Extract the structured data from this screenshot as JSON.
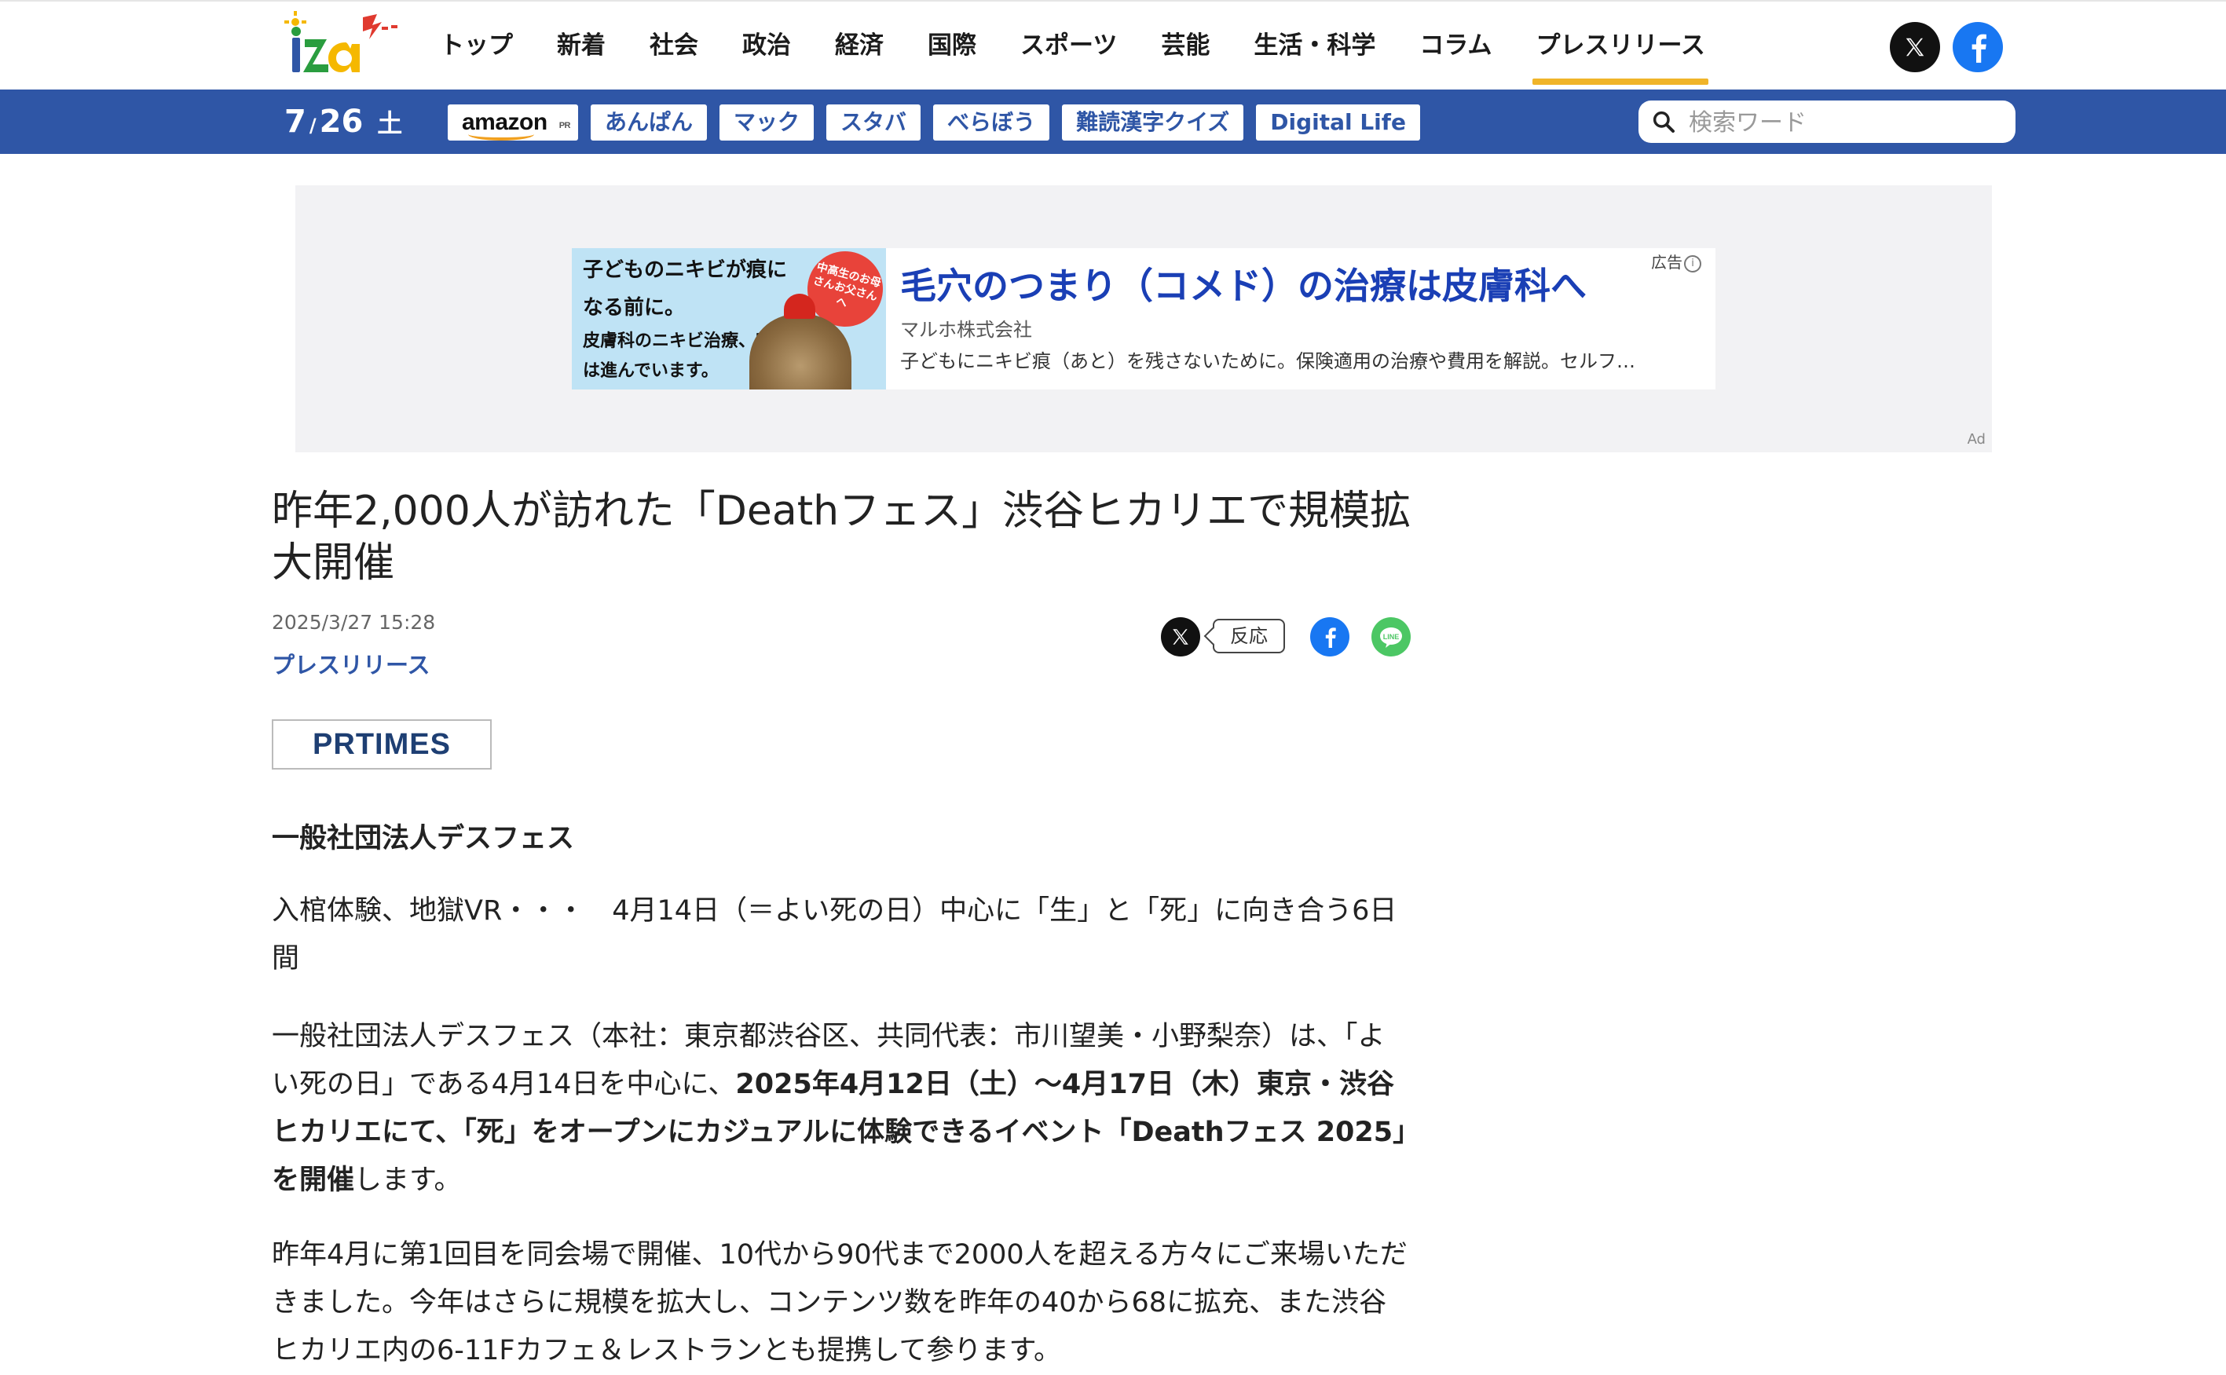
{
  "header": {
    "logo_alt": "iza",
    "nav": [
      "トップ",
      "新着",
      "社会",
      "政治",
      "経済",
      "国際",
      "スポーツ",
      "芸能",
      "生活・科学",
      "コラム",
      "プレスリリース"
    ],
    "active_nav": "プレスリリース"
  },
  "subbar": {
    "date_month": "7",
    "date_day": "26",
    "date_dow": "土",
    "amazon_label": "amazon",
    "amazon_pr": "PR",
    "tags": [
      "あんぱん",
      "マック",
      "スタバ",
      "べらぼう",
      "難読漢字クイズ",
      "Digital Life"
    ],
    "search_placeholder": "検索ワード"
  },
  "ad": {
    "image_text1": "子どものニキビが痕になる前に。",
    "image_text2": "皮膚科のニキビ治療、実は進んでいます。",
    "badge": "中高生のお母さんお父さんへ",
    "title": "毛穴のつまり（コメド）の治療は皮膚科へ",
    "advertiser": "マルホ株式会社",
    "description": "子どもにニキビ痕（あと）を残さないために。保険適用の治療や費用を解説。セルフ…",
    "label": "広告",
    "corner": "Ad"
  },
  "article": {
    "title": "昨年2,000人が訪れた「Deathフェス」渋谷ヒカリエで規模拡大開催",
    "date": "2025/3/27 15:28",
    "category": "プレスリリース",
    "share_react": "反応",
    "source_logo": "PRTIMES",
    "organization": "一般社団法人デスフェス",
    "lead": "入棺体験、地獄VR・・・　4月14日（＝よい死の日）中心に「生」と「死」に向き合う6日間",
    "p2_a": "一般社団法人デスフェス（本社：東京都渋谷区、共同代表：市川望美・小野梨奈）は、「よい死の日」である4月14日を中心に、",
    "p2_bold": "2025年4月12日（土）〜4月17日（木）東京・渋谷ヒカリエにて、「死」をオープンにカジュアルに体験できるイベント「Deathフェス 2025」を開催",
    "p2_c": "します。",
    "p3": "昨年4月に第1回目を同会場で開催、10代から90代まで2000人を超える方々にご来場いただきました。今年はさらに規模を拡大し、コンテンツ数を昨年の40から68に拡充、また渋谷ヒカリエ内の6-11Fカフェ＆レストランとも提携して参ります。"
  },
  "colors": {
    "brand_blue": "#2f56a6",
    "active_underline": "#f0b429",
    "ad_title": "#1a3fb5"
  }
}
